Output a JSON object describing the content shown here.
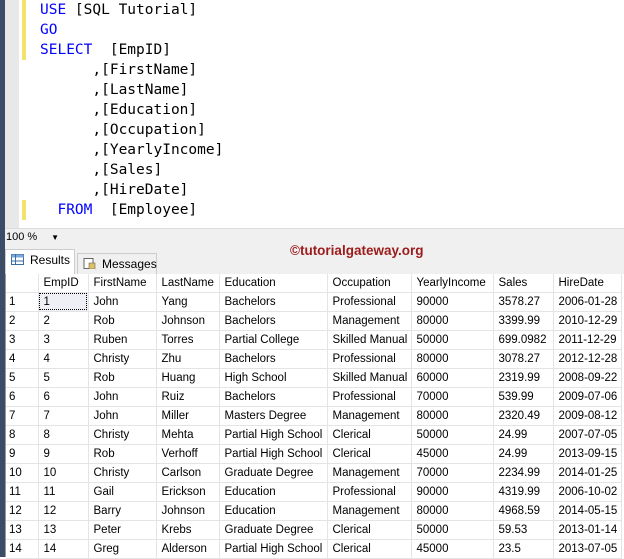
{
  "editor": {
    "lines": [
      {
        "kw": "USE",
        "rest": " [SQL Tutorial]",
        "indent": ""
      },
      {
        "kw": "GO",
        "rest": "",
        "indent": ""
      },
      {
        "kw": "SELECT",
        "rest": "  [EmpID]",
        "indent": ""
      },
      {
        "kw": "",
        "rest": "      ,[FirstName]",
        "indent": ""
      },
      {
        "kw": "",
        "rest": "      ,[LastName]",
        "indent": ""
      },
      {
        "kw": "",
        "rest": "      ,[Education]",
        "indent": ""
      },
      {
        "kw": "",
        "rest": "      ,[Occupation]",
        "indent": ""
      },
      {
        "kw": "",
        "rest": "      ,[YearlyIncome]",
        "indent": ""
      },
      {
        "kw": "",
        "rest": "      ,[Sales]",
        "indent": ""
      },
      {
        "kw": "",
        "rest": "      ,[HireDate]",
        "indent": ""
      },
      {
        "kw": "FROM",
        "rest": "  [Employee]",
        "indent": "  "
      }
    ]
  },
  "zoom": {
    "value": "100 %"
  },
  "tabs": {
    "results": "Results",
    "messages": "Messages"
  },
  "watermark": "©tutorialgateway.org",
  "grid": {
    "columns": [
      "",
      "EmpID",
      "FirstName",
      "LastName",
      "Education",
      "Occupation",
      "YearlyIncome",
      "Sales",
      "HireDate"
    ],
    "rows": [
      [
        "1",
        "1",
        "John",
        "Yang",
        "Bachelors",
        "Professional",
        "90000",
        "3578.27",
        "2006-01-28"
      ],
      [
        "2",
        "2",
        "Rob",
        "Johnson",
        "Bachelors",
        "Management",
        "80000",
        "3399.99",
        "2010-12-29"
      ],
      [
        "3",
        "3",
        "Ruben",
        "Torres",
        "Partial College",
        "Skilled Manual",
        "50000",
        "699.0982",
        "2011-12-29"
      ],
      [
        "4",
        "4",
        "Christy",
        "Zhu",
        "Bachelors",
        "Professional",
        "80000",
        "3078.27",
        "2012-12-28"
      ],
      [
        "5",
        "5",
        "Rob",
        "Huang",
        "High School",
        "Skilled Manual",
        "60000",
        "2319.99",
        "2008-09-22"
      ],
      [
        "6",
        "6",
        "John",
        "Ruiz",
        "Bachelors",
        "Professional",
        "70000",
        "539.99",
        "2009-07-06"
      ],
      [
        "7",
        "7",
        "John",
        "Miller",
        "Masters Degree",
        "Management",
        "80000",
        "2320.49",
        "2009-08-12"
      ],
      [
        "8",
        "8",
        "Christy",
        "Mehta",
        "Partial High School",
        "Clerical",
        "50000",
        "24.99",
        "2007-07-05"
      ],
      [
        "9",
        "9",
        "Rob",
        "Verhoff",
        "Partial High School",
        "Clerical",
        "45000",
        "24.99",
        "2013-09-15"
      ],
      [
        "10",
        "10",
        "Christy",
        "Carlson",
        "Graduate Degree",
        "Management",
        "70000",
        "2234.99",
        "2014-01-25"
      ],
      [
        "11",
        "11",
        "Gail",
        "Erickson",
        "Education",
        "Professional",
        "90000",
        "4319.99",
        "2006-10-02"
      ],
      [
        "12",
        "12",
        "Barry",
        "Johnson",
        "Education",
        "Management",
        "80000",
        "4968.59",
        "2014-05-15"
      ],
      [
        "13",
        "13",
        "Peter",
        "Krebs",
        "Graduate Degree",
        "Clerical",
        "50000",
        "59.53",
        "2013-01-14"
      ],
      [
        "14",
        "14",
        "Greg",
        "Alderson",
        "Partial High School",
        "Clerical",
        "45000",
        "23.5",
        "2013-07-05"
      ]
    ]
  }
}
